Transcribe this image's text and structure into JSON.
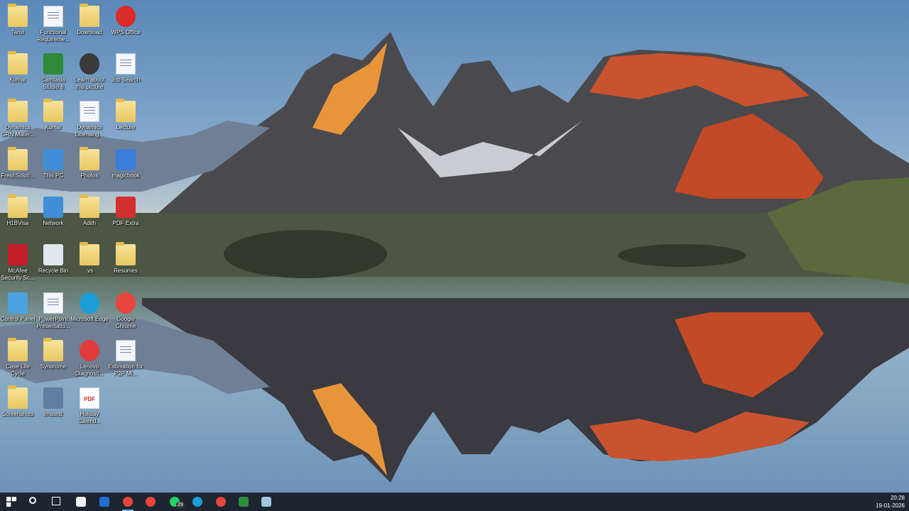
{
  "desktop": {
    "icons": [
      {
        "label": "Tanvi",
        "icon": "folder-icon"
      },
      {
        "label": "Functional Requireme...",
        "icon": "document-icon"
      },
      {
        "label": "Download",
        "icon": "folder-icon"
      },
      {
        "label": "WPS Office",
        "icon": "wps-office-icon"
      },
      {
        "label": "Kumar",
        "icon": "folder-icon"
      },
      {
        "label": "Camtasia Studio 8",
        "icon": "camtasia-icon"
      },
      {
        "label": "Learn about this picture",
        "icon": "learn-about-picture-icon"
      },
      {
        "label": "Job Search",
        "icon": "document-icon"
      },
      {
        "label": "Dynamics GRN Mater...",
        "icon": "folder-icon"
      },
      {
        "label": "Kumar",
        "icon": "user-folder-icon"
      },
      {
        "label": "Dynamics Licensing...",
        "icon": "document-icon"
      },
      {
        "label": "Lecture",
        "icon": "folder-icon"
      },
      {
        "label": "FreshSoluti...",
        "icon": "folder-icon"
      },
      {
        "label": "This PC",
        "icon": "this-pc-icon"
      },
      {
        "label": "Photos",
        "icon": "folder-icon"
      },
      {
        "label": "magicbook",
        "icon": "magicbook-icon"
      },
      {
        "label": "H1BVisa",
        "icon": "folder-icon"
      },
      {
        "label": "Network",
        "icon": "network-icon"
      },
      {
        "label": "Adith",
        "icon": "folder-icon"
      },
      {
        "label": "PDF Extra",
        "icon": "pdf-extra-icon"
      },
      {
        "label": "McAfee Security Sc...",
        "icon": "mcafee-icon"
      },
      {
        "label": "Recycle Bin",
        "icon": "recycle-bin-icon"
      },
      {
        "label": ".vs",
        "icon": "folder-icon"
      },
      {
        "label": "Resumes",
        "icon": "folder-icon"
      },
      {
        "label": "Control Panel",
        "icon": "control-panel-icon"
      },
      {
        "label": "PowerPoint Presentatio...",
        "icon": "document-icon"
      },
      {
        "label": "Microsoft Edge",
        "icon": "edge-icon"
      },
      {
        "label": "Google Chrome",
        "icon": "chrome-icon"
      },
      {
        "label": "Case Life Cycle",
        "icon": "folder-icon"
      },
      {
        "label": "Syndrome",
        "icon": "folder-icon"
      },
      {
        "label": "Lenovo Diagnosti...",
        "icon": "lenovo-diagnostics-icon"
      },
      {
        "label": "Estimation for P2P Mi...",
        "icon": "document-icon"
      },
      {
        "label": "Screenshots",
        "icon": "folder-icon"
      },
      {
        "label": "Imatest",
        "icon": "imatest-icon"
      },
      {
        "label": "Holiday Calend...",
        "icon": "pdf-icon"
      }
    ]
  },
  "taskbar": {
    "items": [
      {
        "icon": "start-icon"
      },
      {
        "icon": "search-icon"
      },
      {
        "icon": "task-view-icon"
      },
      {
        "icon": "store-icon"
      },
      {
        "icon": "outlook-icon"
      },
      {
        "icon": "chrome-icon"
      },
      {
        "icon": "chrome-icon"
      },
      {
        "icon": "whatsapp-icon",
        "badge": "29"
      },
      {
        "icon": "edge-icon"
      },
      {
        "icon": "chrome-icon"
      },
      {
        "icon": "camtasia-icon"
      },
      {
        "icon": "notepad-icon"
      }
    ],
    "clock": {
      "time": "20:28",
      "date": "19-01-2026"
    }
  },
  "colors": {
    "taskbar": "#1c2530",
    "active_indicator": "#7fb3e8",
    "icon_label": "#ffffff"
  }
}
